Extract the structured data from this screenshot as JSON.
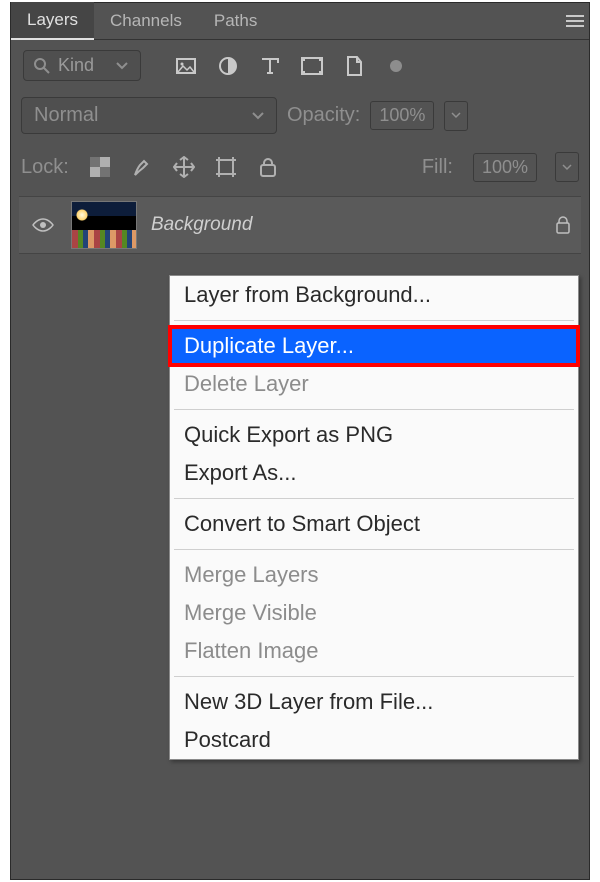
{
  "tabs": [
    "Layers",
    "Channels",
    "Paths"
  ],
  "filter": {
    "kind": "Kind"
  },
  "blend": {
    "mode": "Normal",
    "opacity_label": "Opacity:",
    "opacity": "100%"
  },
  "lock": {
    "label": "Lock:",
    "fill_label": "Fill:",
    "fill": "100%"
  },
  "layer": {
    "name": "Background"
  },
  "menu": [
    "Layer from Background...",
    "Duplicate Layer...",
    "Delete Layer",
    "Quick Export as PNG",
    "Export As...",
    "Convert to Smart Object",
    "Merge Layers",
    "Merge Visible",
    "Flatten Image",
    "New 3D Layer from File...",
    "Postcard"
  ],
  "menu_state": {
    "highlighted": "Duplicate Layer...",
    "disabled": [
      "Delete Layer",
      "Merge Layers",
      "Merge Visible",
      "Flatten Image"
    ]
  }
}
